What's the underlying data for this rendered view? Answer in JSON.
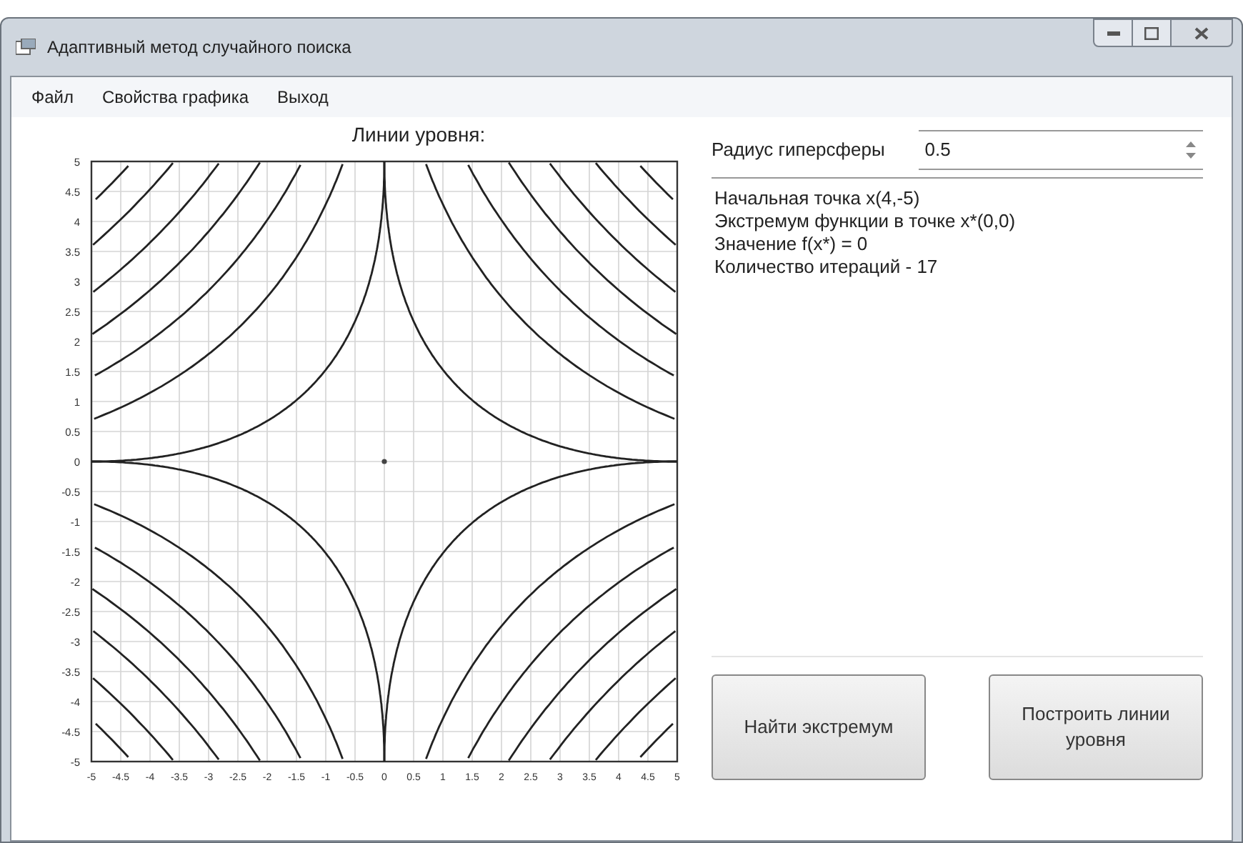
{
  "window": {
    "title": "Адаптивный метод случайного поиска"
  },
  "menu": [
    "Файл",
    "Свойства графика",
    "Выход"
  ],
  "chart": {
    "title": "Линии уровня:",
    "yticks": [
      "5",
      "4.5",
      "4",
      "3.5",
      "3",
      "2.5",
      "2",
      "1.5",
      "1",
      "0.5",
      "0",
      "-0.5",
      "-1",
      "-1.5",
      "-2",
      "-2.5",
      "-3",
      "-3.5",
      "-4",
      "-4.5",
      "-5"
    ],
    "xticks": [
      "-5",
      "-4.5",
      "-4",
      "-3.5",
      "-3",
      "-2.5",
      "-2",
      "-1.5",
      "-1",
      "-0.5",
      "0",
      "0.5",
      "1",
      "1.5",
      "2",
      "2.5",
      "3",
      "3.5",
      "4",
      "4.5",
      "5"
    ]
  },
  "radius": {
    "label": "Радиус гиперсферы",
    "value": "0.5"
  },
  "output": [
    "Начальная точка x(4,-5)",
    "Экстремум функции в точке x*(0,0)",
    "Значение f(x*) = 0",
    "Количество итераций - 17"
  ],
  "buttons": [
    "Найти экстремум",
    "Построить линии уровня"
  ]
}
